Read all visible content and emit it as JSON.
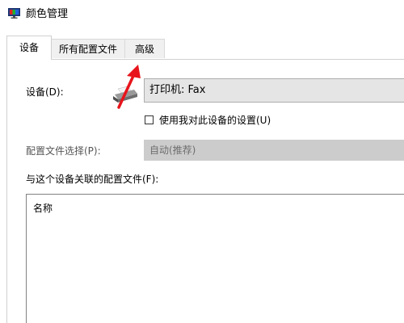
{
  "window": {
    "title": "颜色管理",
    "icon": "monitor-icon"
  },
  "tabs": [
    {
      "label": "设备",
      "active": true
    },
    {
      "label": "所有配置文件",
      "active": false
    },
    {
      "label": "高级",
      "active": false
    }
  ],
  "device": {
    "label": "设备(D):",
    "value": "打印机: Fax",
    "icon": "printer-icon"
  },
  "use_settings": {
    "label": "使用我对此设备的设置(U)",
    "checked": false
  },
  "profile_selection": {
    "label": "配置文件选择(P):",
    "value": "自动(推荐)",
    "enabled": false
  },
  "associated": {
    "label": "与这个设备关联的配置文件(F):",
    "column_header": "名称",
    "rows": []
  },
  "annotation": {
    "arrow_color": "#e8141b",
    "points_to": "tab-advanced"
  }
}
